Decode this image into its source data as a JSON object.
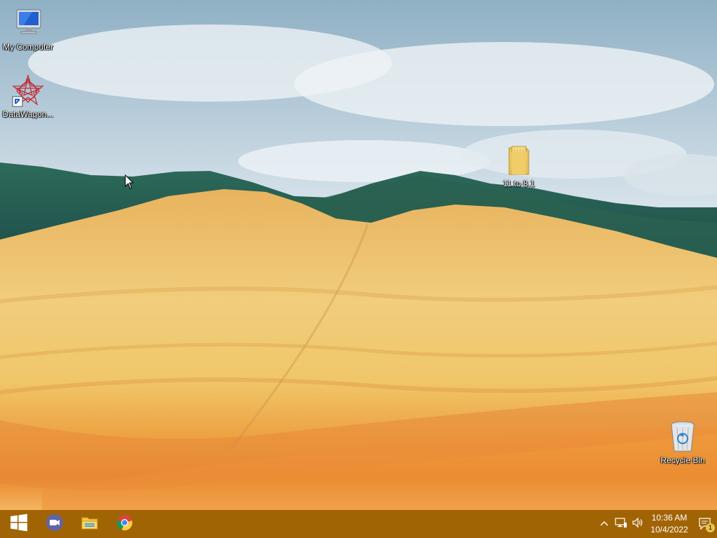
{
  "desktop": {
    "icons": [
      {
        "label": "My Computer",
        "icon": "my-computer-icon"
      },
      {
        "label": "DataWagon...",
        "icon": "datawagon-icon"
      },
      {
        "label": "11 to 8.1",
        "icon": "folder-icon"
      },
      {
        "label": "Recycle Bin",
        "icon": "recycle-bin-icon"
      }
    ]
  },
  "taskbar": {
    "color": "#a16405",
    "pinned": [
      {
        "icon": "windows-start-icon"
      },
      {
        "icon": "video-meeting-icon"
      },
      {
        "icon": "file-explorer-icon"
      },
      {
        "icon": "chrome-icon"
      }
    ],
    "tray": {
      "icons": [
        "chevron-up-icon",
        "network-icon",
        "volume-icon",
        "notification-icon"
      ],
      "time": "10:36 AM",
      "date": "10/4/2022",
      "notification_count": "1"
    }
  }
}
